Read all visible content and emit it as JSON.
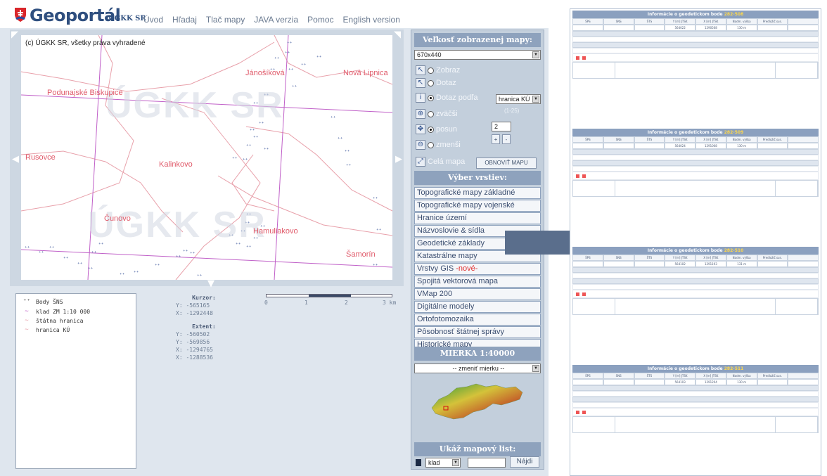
{
  "header": {
    "title": "Geoportál",
    "subtitle": "ÚGKK SR",
    "nav": [
      "Úvod",
      "Hľadaj",
      "Tlač mapy",
      "JAVA verzia",
      "Pomoc",
      "English version"
    ]
  },
  "map": {
    "copyright": "(c) ÚGKK SR, všetky práva vyhradené",
    "watermark": "ÚGKK SR",
    "places": [
      {
        "name": "Podunajské Biskupice"
      },
      {
        "name": "Jánošíková"
      },
      {
        "name": "Nová Lipnica"
      },
      {
        "name": "Rusovce"
      },
      {
        "name": "Kalinkovo"
      },
      {
        "name": "Čunovo"
      },
      {
        "name": "Hamuliakovo"
      },
      {
        "name": "Šamorín"
      }
    ]
  },
  "legend": {
    "items": [
      {
        "symbol": "point",
        "label": "Body ŠNS"
      },
      {
        "symbol": "line",
        "label": "klad ZM 1:10 000"
      },
      {
        "symbol": "line",
        "label": "štátna hranica"
      },
      {
        "symbol": "line",
        "label": "hranica KÚ"
      }
    ]
  },
  "cursor": {
    "title": "Kurzor:",
    "y": "Y: -565165",
    "x": "X: -1292448",
    "extent_title": "Extent:",
    "extent": [
      "Y: -560502",
      "Y: -569856",
      "X: -1294765",
      "X: -1288536"
    ]
  },
  "scalebar": {
    "ticks": [
      "0",
      "1",
      "2",
      "3 km"
    ]
  },
  "panel": {
    "size_header": "Veľkosť zobrazenej mapy:",
    "size_value": "670x440",
    "tools": {
      "zobraz": "Zobraz",
      "dotaz": "Dotaz",
      "dotaz_podla": "Dotaz podľa",
      "dotaz_podla_value": "hranica KÚ",
      "zvacsi": "zväčši",
      "posun": "posun",
      "zmensi": "zmenši",
      "zoom_range": "(1-25)",
      "zoom_value": "2",
      "plus": "+",
      "minus": "-",
      "cela_mapa": "Celá mapa",
      "obnovit": "OBNOVIŤ MAPU"
    },
    "layers_header": "Výber vrstiev:",
    "layers": [
      "Topografické mapy základné",
      "Topografické mapy vojenské",
      "Hranice území",
      "Názvoslovie & sídla",
      "Geodetické základy",
      "Katastrálne mapy",
      "Vrstvy GIS",
      "Spojitá vektorová mapa",
      "VMap 200",
      "Digitálne modely",
      "Ortofotomozaika",
      "Pôsobnosť štátnej správy",
      "Historické mapy"
    ],
    "layers_new_badge": "-nové-",
    "scale_header": "MIERKA 1:40000",
    "scale_select": "-- zmeniť mierku --",
    "sheet_header": "Ukáž mapový list:",
    "sheet_select": "klad",
    "sheet_button": "Nájdi"
  },
  "detail": {
    "header_text": "Informácie o geodetickom bode",
    "columns": [
      "ŠPS",
      "SNS",
      "ŠTS",
      "Y [m] JTSK",
      "X [m] JTSK",
      "Nadm. výška",
      "Predložič.sus."
    ],
    "blocks": [
      {
        "num": "282-508",
        "y": "564022",
        "x": "1290568",
        "h": "130 m"
      },
      {
        "num": "282-509",
        "y": "564024",
        "x": "1291008",
        "h": "130 m"
      },
      {
        "num": "282-510",
        "y": "564102",
        "x": "1291193",
        "h": "131 m"
      },
      {
        "num": "282-511",
        "y": "564103",
        "x": "1291204",
        "h": "130 m"
      }
    ]
  },
  "colors": {
    "accent": "#8ea2bd",
    "brand": "#2f4f7f",
    "place": "#e05a6a",
    "grid": "#c060c8",
    "arrow": "#5a6e8c"
  }
}
